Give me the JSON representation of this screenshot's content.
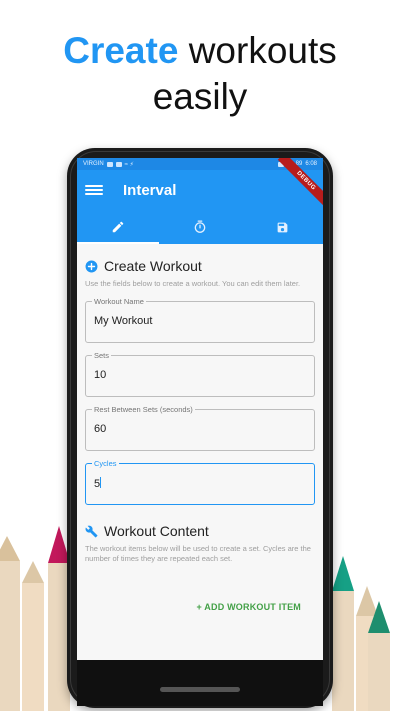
{
  "headline": {
    "accent": "Create",
    "rest": " workouts",
    "line2": "easily"
  },
  "colors": {
    "accent": "#2196f3",
    "action_green": "#43a047",
    "debug_red": "#b71c1c"
  },
  "statusbar": {
    "carrier": "VIRGIN",
    "extra": "≈ ⚡",
    "battery": "89",
    "time": "6:08"
  },
  "appbar": {
    "title": "Interval",
    "debug_label": "DEBUG"
  },
  "tabs": [
    {
      "icon": "pencil-icon",
      "selected": true
    },
    {
      "icon": "timer-icon",
      "selected": false
    },
    {
      "icon": "save-icon",
      "selected": false
    }
  ],
  "create_section": {
    "title": "Create Workout",
    "help": "Use the fields below to create a workout. You can edit them later."
  },
  "fields": {
    "workout_name": {
      "label": "Workout Name",
      "value": "My Workout"
    },
    "sets": {
      "label": "Sets",
      "value": "10"
    },
    "rest": {
      "label": "Rest Between Sets (seconds)",
      "value": "60"
    },
    "cycles": {
      "label": "Cycles",
      "value": "5"
    }
  },
  "content_section": {
    "title": "Workout Content",
    "help": "The workout items below will be used to create a set. Cycles are the number of times they are repeated each set."
  },
  "actions": {
    "add_item": "+ ADD WORKOUT ITEM"
  }
}
